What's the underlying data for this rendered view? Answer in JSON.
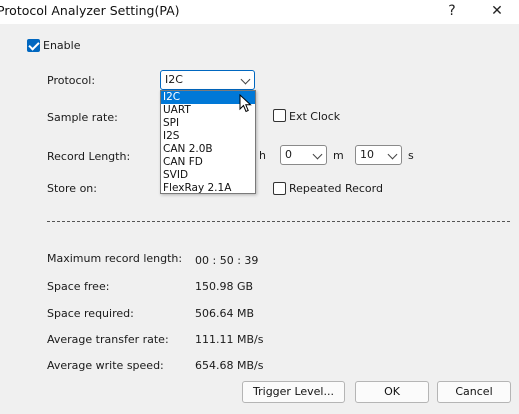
{
  "window": {
    "title": "Protocol Analyzer Setting(PA)",
    "help_glyph": "?",
    "close_glyph": "✕"
  },
  "enable": {
    "label": "Enable",
    "checked": true
  },
  "protocol": {
    "label": "Protocol:",
    "selected": "I2C",
    "options": [
      "I2C",
      "UART",
      "SPI",
      "I2S",
      "CAN 2.0B",
      "CAN FD",
      "SVID",
      "FlexRay 2.1A"
    ],
    "highlighted_index": 0
  },
  "sample_rate": {
    "label": "Sample rate:"
  },
  "ext_clock": {
    "label": "Ext Clock",
    "checked": false
  },
  "record_length": {
    "label": "Record Length:",
    "hours_unit": "h",
    "minutes_value": "0",
    "minutes_unit": "m",
    "seconds_value": "10",
    "seconds_unit": "s"
  },
  "store_on": {
    "label": "Store on:"
  },
  "repeated_record": {
    "label": "Repeated Record",
    "checked": false
  },
  "stats": [
    {
      "label": "Maximum record length:",
      "value": "00 : 50 : 39"
    },
    {
      "label": "Space free:",
      "value": "150.98 GB"
    },
    {
      "label": "Space required:",
      "value": "506.64 MB"
    },
    {
      "label": "Average transfer rate:",
      "value": "111.11 MB/s"
    },
    {
      "label": "Average write speed:",
      "value": "654.68 MB/s"
    }
  ],
  "buttons": {
    "trigger": "Trigger Level...",
    "ok": "OK",
    "cancel": "Cancel"
  },
  "colors": {
    "accent": "#0067c0",
    "highlight": "#0078d7"
  }
}
